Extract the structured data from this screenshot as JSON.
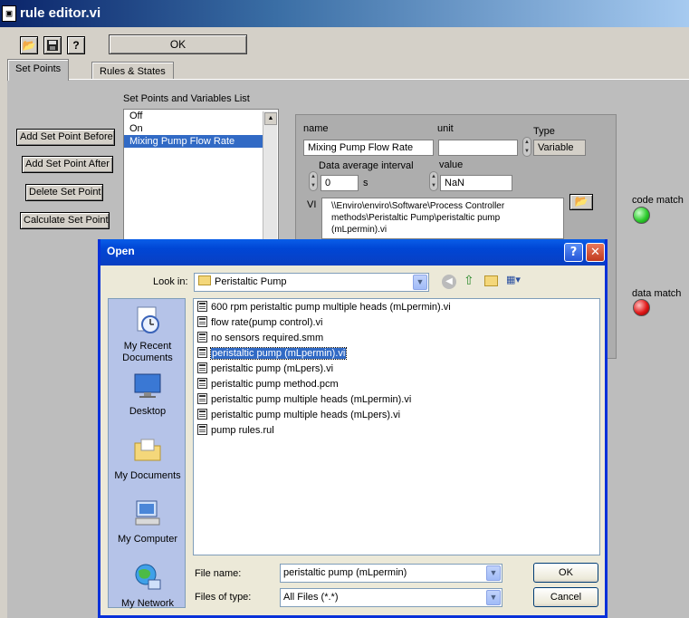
{
  "window": {
    "title": "rule editor.vi"
  },
  "toolbar": {
    "ok_label": "OK"
  },
  "tabs": [
    {
      "label": "Set Points"
    },
    {
      "label": "Rules & States"
    }
  ],
  "setpoints": {
    "buttons": [
      "Add Set Point Before",
      "Add Set Point After",
      "Delete Set Point",
      "Calculate Set Point"
    ],
    "list_label": "Set Points and Variables List",
    "items": [
      "Off",
      "On",
      "Mixing Pump Flow Rate"
    ],
    "selected_index": 2
  },
  "detail": {
    "name_label": "name",
    "name_value": "Mixing Pump Flow Rate",
    "unit_label": "unit",
    "unit_value": "",
    "type_label": "Type",
    "type_value": "Variable",
    "interval_label": "Data average interval",
    "interval_value": "0",
    "interval_unit": "s",
    "value_label": "value",
    "value_value": "NaN",
    "vi_label": "VI",
    "vi_path_line1": "\\\\Enviro\\enviro\\Software\\Process Controller",
    "vi_path_line2": "methods\\Peristaltic Pump\\peristaltic pump",
    "vi_path_line3": "(mLpermin).vi"
  },
  "indicators": {
    "code_match_label": "code match",
    "code_match_color": "#2ecc2e",
    "data_match_label": "data match",
    "data_match_color": "#e01818"
  },
  "dialog": {
    "title": "Open",
    "look_in_label": "Look in:",
    "look_in_value": "Peristaltic Pump",
    "places": [
      "My Recent Documents",
      "Desktop",
      "My Documents",
      "My Computer",
      "My Network"
    ],
    "files": [
      "600 rpm peristaltic pump multiple heads (mLpermin).vi",
      "flow rate(pump control).vi",
      "no sensors required.smm",
      "peristaltic pump (mLpermin).vi",
      "peristaltic pump (mLpers).vi",
      "peristaltic pump method.pcm",
      "peristaltic pump multiple heads (mLpermin).vi",
      "peristaltic pump multiple heads (mLpers).vi",
      "pump rules.rul"
    ],
    "selected_file_index": 3,
    "file_name_label": "File name:",
    "file_name_value": "peristaltic pump (mLpermin)",
    "files_of_type_label": "Files of type:",
    "files_of_type_value": "All Files (*.*)",
    "ok_label": "OK",
    "cancel_label": "Cancel"
  }
}
